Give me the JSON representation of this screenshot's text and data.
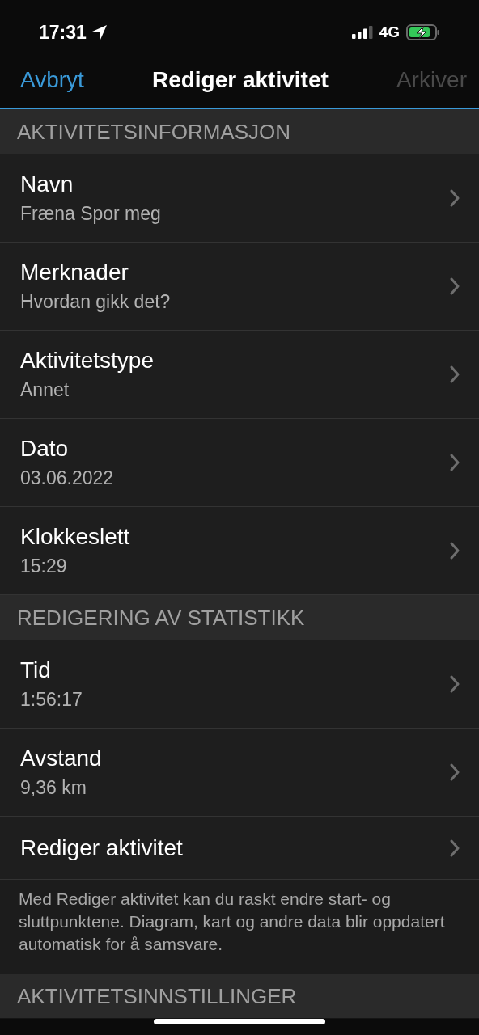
{
  "status_bar": {
    "time": "17:31",
    "network": "4G"
  },
  "nav": {
    "cancel": "Avbryt",
    "title": "Rediger aktivitet",
    "archive": {
      "label": "Arkiver",
      "disabled": true
    }
  },
  "sections": [
    {
      "header": "AKTIVITETSINFORMASJON",
      "rows": [
        {
          "title": "Navn",
          "value": "Fræna Spor meg"
        },
        {
          "title": "Merknader",
          "value": "Hvordan gikk det?"
        },
        {
          "title": "Aktivitetstype",
          "value": "Annet"
        },
        {
          "title": "Dato",
          "value": "03.06.2022"
        },
        {
          "title": "Klokkeslett",
          "value": "15:29"
        }
      ]
    },
    {
      "header": "REDIGERING AV STATISTIKK",
      "rows": [
        {
          "title": "Tid",
          "value": "1:56:17"
        },
        {
          "title": "Avstand",
          "value": "9,36 km"
        },
        {
          "title": "Rediger aktivitet"
        }
      ],
      "footer": "Med Rediger aktivitet kan du raskt endre start- og sluttpunktene. Diagram, kart og andre data blir oppdatert automatisk for å samsvare."
    },
    {
      "header": "AKTIVITETSINNSTILLINGER"
    }
  ]
}
